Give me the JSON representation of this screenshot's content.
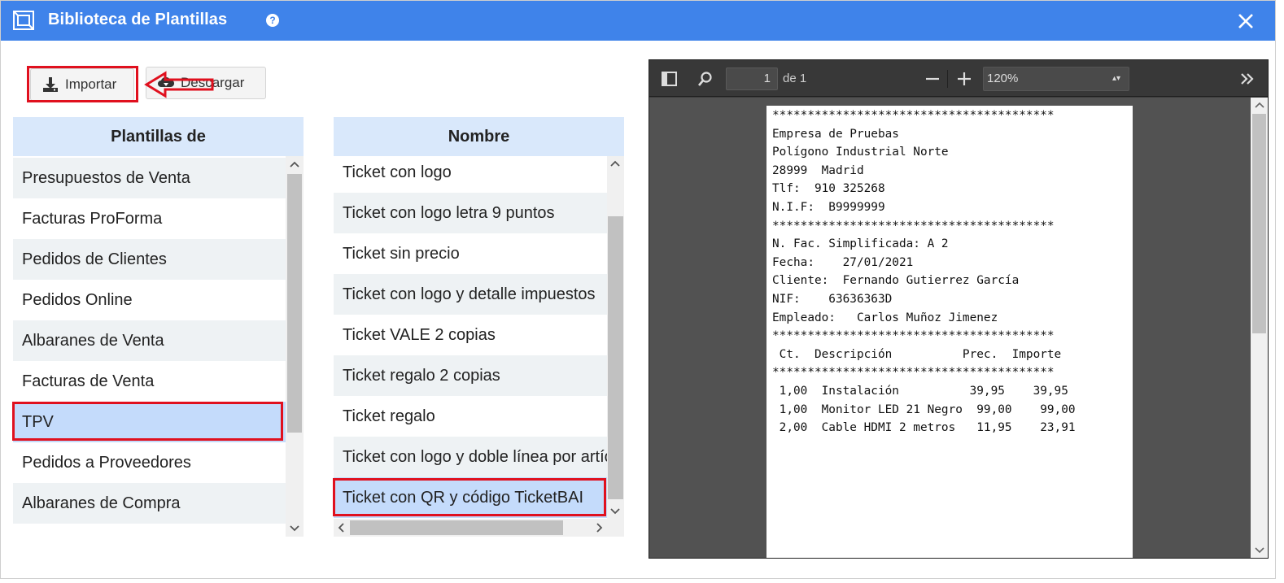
{
  "window": {
    "title": "Biblioteca de Plantillas",
    "help_glyph": "?",
    "icons": {
      "app": "template-library-icon",
      "help": "help-icon",
      "close": "close-icon"
    }
  },
  "toolbar": {
    "import_label": "Importar",
    "download_label": "Descargar"
  },
  "templates_of": {
    "header": "Plantillas de",
    "selected": "TPV",
    "items": [
      "Presupuestos de Venta",
      "Facturas ProForma",
      "Pedidos de Clientes",
      "Pedidos Online",
      "Albaranes de Venta",
      "Facturas de Venta",
      "TPV",
      "Pedidos a Proveedores",
      "Albaranes de Compra"
    ]
  },
  "names": {
    "header": "Nombre",
    "selected": "Ticket con QR y código TicketBAI",
    "items": [
      "Ticket con logo",
      "Ticket con logo letra 9 puntos",
      "Ticket sin precio",
      "Ticket con logo y detalle impuestos",
      "Ticket VALE 2 copias",
      "Ticket regalo 2 copias",
      "Ticket regalo",
      "Ticket con logo y doble línea por artícu",
      "Ticket con QR y código TicketBAI"
    ]
  },
  "pdf_viewer": {
    "page": "1",
    "page_of": "de 1",
    "zoom": "120%",
    "ticket_lines": [
      "****************************************",
      "Empresa de Pruebas",
      "Polígono Industrial Norte",
      "28999  Madrid",
      "Tlf:  910 325268",
      "N.I.F:  B9999999",
      "****************************************",
      "N. Fac. Simplificada: A 2",
      "Fecha:    27/01/2021",
      "Cliente:  Fernando Gutierrez García",
      "NIF:    63636363D",
      "Empleado:   Carlos Muñoz Jimenez",
      "****************************************",
      " Ct.  Descripción          Prec.  Importe",
      "****************************************",
      " 1,00  Instalación          39,95    39,95",
      " 1,00  Monitor LED 21 Negro  99,00    99,00",
      " 2,00  Cable HDMI 2 metros   11,95    23,91"
    ]
  },
  "colors": {
    "titlebar": "#3f83ea",
    "highlight": "#e0101e",
    "header_bg": "#d9e8fb",
    "selected_bg": "#c4dbfb"
  }
}
